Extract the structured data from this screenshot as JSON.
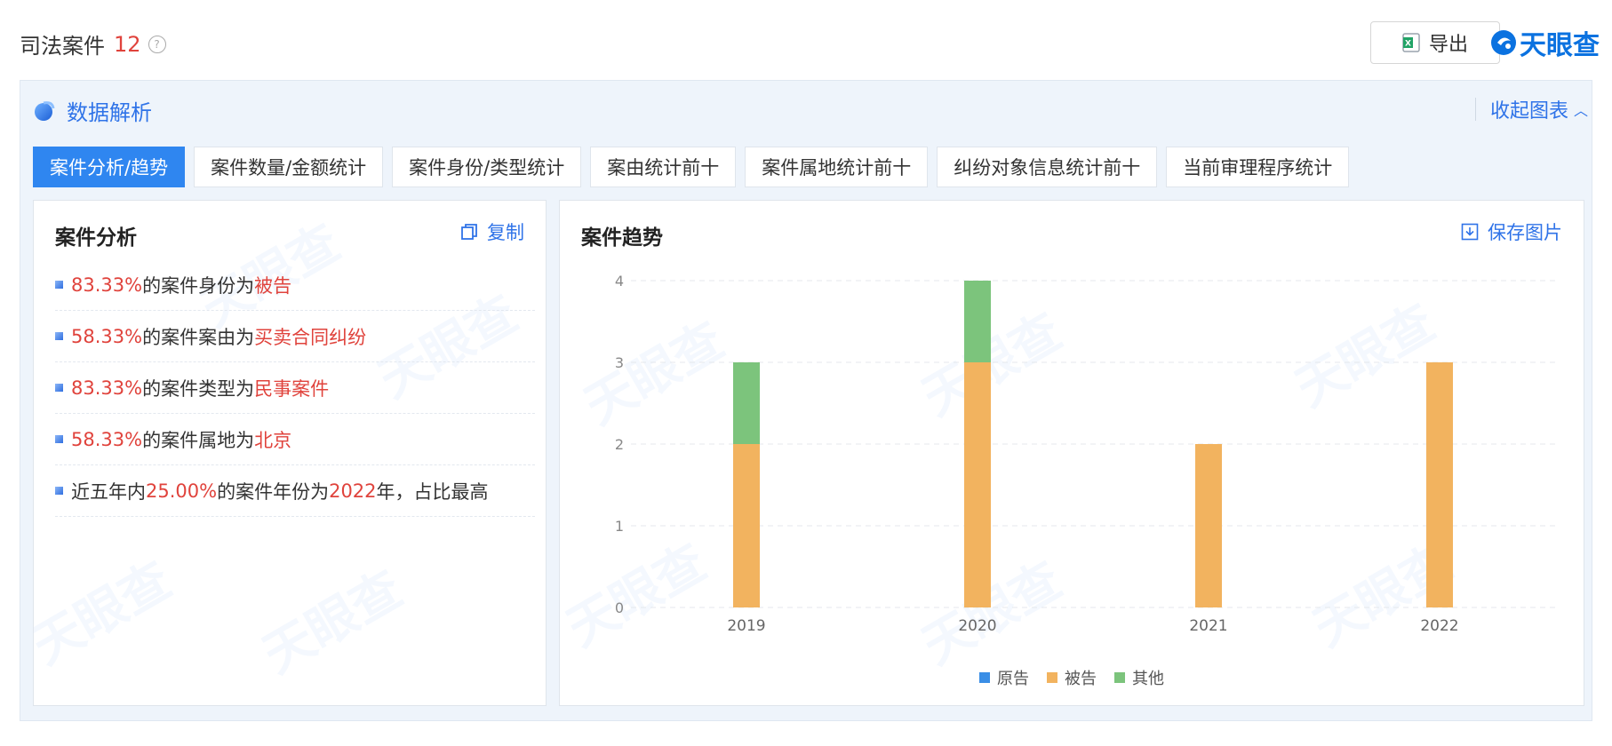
{
  "header": {
    "title": "司法案件",
    "count": "12",
    "help_icon": "?",
    "export_label": "导出",
    "brand": "天眼查"
  },
  "panel": {
    "title": "数据解析",
    "collapse_label": "收起图表",
    "tabs": [
      {
        "label": "案件分析/趋势",
        "active": true
      },
      {
        "label": "案件数量/金额统计",
        "active": false
      },
      {
        "label": "案件身份/类型统计",
        "active": false
      },
      {
        "label": "案由统计前十",
        "active": false
      },
      {
        "label": "案件属地统计前十",
        "active": false
      },
      {
        "label": "纠纷对象信息统计前十",
        "active": false
      },
      {
        "label": "当前审理程序统计",
        "active": false
      }
    ]
  },
  "analysis": {
    "title": "案件分析",
    "copy_label": "复制",
    "items": [
      {
        "percent": "83.33%",
        "text": "的案件身份为",
        "value": "被告"
      },
      {
        "percent": "58.33%",
        "text": "的案件案由为",
        "value": "买卖合同纠纷"
      },
      {
        "percent": "83.33%",
        "text": "的案件类型为",
        "value": "民事案件"
      },
      {
        "percent": "58.33%",
        "text": "的案件属地为",
        "value": "北京"
      },
      {
        "prefix": "近五年内",
        "percent": "25.00%",
        "text": "的案件年份为",
        "value": "2022",
        "suffix": "年，占比最高"
      }
    ]
  },
  "trend": {
    "title": "案件趋势",
    "save_label": "保存图片"
  },
  "watermark_text": "天眼查",
  "colors": {
    "accent": "#2f86f0",
    "plaintiff": "#3a8ee6",
    "defendant": "#f2b35f",
    "other": "#7cc47c",
    "highlight_red": "#e0433c"
  },
  "chart_data": {
    "type": "bar",
    "stacked": true,
    "categories": [
      "2019",
      "2020",
      "2021",
      "2022"
    ],
    "series": [
      {
        "name": "原告",
        "color": "#3a8ee6",
        "values": [
          0,
          0,
          0,
          0
        ]
      },
      {
        "name": "被告",
        "color": "#f2b35f",
        "values": [
          2,
          3,
          2,
          3
        ]
      },
      {
        "name": "其他",
        "color": "#7cc47c",
        "values": [
          1,
          1,
          0,
          0
        ]
      }
    ],
    "ylim": [
      0,
      4
    ],
    "yticks": [
      0,
      1,
      2,
      3,
      4
    ],
    "grid": true,
    "legend_position": "bottom"
  }
}
